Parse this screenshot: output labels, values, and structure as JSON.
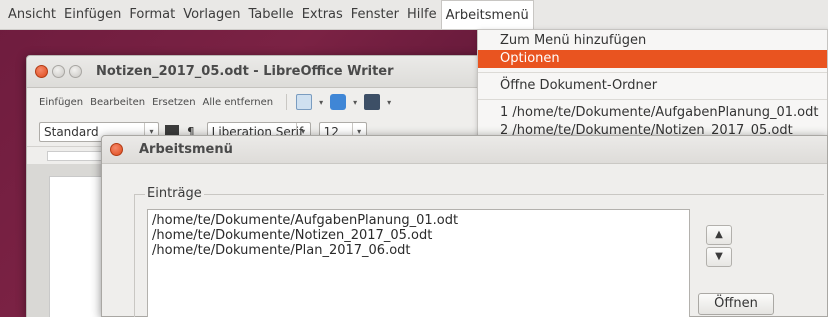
{
  "menubar": {
    "items": [
      "Ansicht",
      "Einfügen",
      "Format",
      "Vorlagen",
      "Tabelle",
      "Extras",
      "Fenster",
      "Hilfe",
      "Arbeitsmenü"
    ]
  },
  "dropdown": {
    "items": [
      "Zum Menü hinzufügen",
      "Optionen",
      "Öffne Dokument-Ordner",
      "1 /home/te/Dokumente/AufgabenPlanung_01.odt",
      "2 /home/te/Dokumente/Notizen_2017_05.odt"
    ],
    "highlighted_index": 1
  },
  "writer": {
    "title": "Notizen_2017_05.odt - LibreOffice Writer",
    "toolbar_links": [
      "Einfügen",
      "Bearbeiten",
      "Ersetzen",
      "Alle entfernen"
    ],
    "style_value": "Standard",
    "font_value": "Liberation Serif",
    "size_value": "12"
  },
  "dialog": {
    "title": "Arbeitsmenü",
    "group_label": "Einträge",
    "entries": [
      "/home/te/Dokumente/AufgabenPlanung_01.odt",
      "/home/te/Dokumente/Notizen_2017_05.odt",
      "/home/te/Dokumente/Plan_2017_06.odt"
    ],
    "up_label": "▲",
    "down_label": "▼",
    "open_label": "Öffnen"
  },
  "colors": {
    "accent": "#e95420",
    "desktop": "#6e1c3e"
  }
}
